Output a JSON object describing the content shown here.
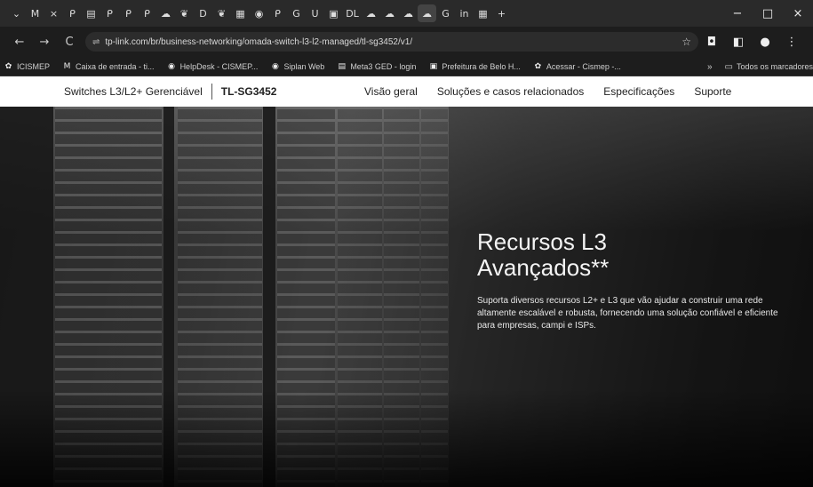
{
  "browser": {
    "tabs": [
      {
        "icon": "chevron-down-icon",
        "glyph": "⌄"
      },
      {
        "icon": "gmail-icon",
        "glyph": "M"
      },
      {
        "icon": "close-icon",
        "glyph": "×"
      },
      {
        "icon": "tplink-icon",
        "glyph": "ᑭ"
      },
      {
        "icon": "doc-icon",
        "glyph": "▤"
      },
      {
        "icon": "tplink-icon",
        "glyph": "ᑭ"
      },
      {
        "icon": "tplink-icon",
        "glyph": "ᑭ"
      },
      {
        "icon": "tplink-icon",
        "glyph": "ᑭ"
      },
      {
        "icon": "cloud-icon",
        "glyph": "☁"
      },
      {
        "icon": "leaf-icon",
        "glyph": "❦"
      },
      {
        "icon": "d-icon",
        "glyph": "D"
      },
      {
        "icon": "leaf-icon",
        "glyph": "❦"
      },
      {
        "icon": "grid-icon",
        "glyph": "▦"
      },
      {
        "icon": "globe-icon",
        "glyph": "◉"
      },
      {
        "icon": "tplink-icon",
        "glyph": "ᑭ"
      },
      {
        "icon": "google-icon",
        "glyph": "G"
      },
      {
        "icon": "u-icon",
        "glyph": "U"
      },
      {
        "icon": "image-icon",
        "glyph": "▣"
      },
      {
        "icon": "dl-icon",
        "glyph": "DL"
      },
      {
        "icon": "cloud-icon",
        "glyph": "☁"
      },
      {
        "icon": "cloud-icon",
        "glyph": "☁"
      },
      {
        "icon": "cloud-icon",
        "glyph": "☁"
      },
      {
        "icon": "cloud-icon",
        "glyph": "☁",
        "active": true
      },
      {
        "icon": "google-icon",
        "glyph": "G"
      },
      {
        "icon": "linkedin-icon",
        "glyph": "in"
      },
      {
        "icon": "grid-icon",
        "glyph": "▦"
      },
      {
        "icon": "new-tab-icon",
        "glyph": "+"
      }
    ],
    "window_controls": [
      "−",
      "□",
      "×"
    ],
    "nav": {
      "back": "←",
      "forward": "→",
      "reload": "C"
    },
    "url": "tp-link.com/br/business-networking/omada-switch-l3-l2-managed/tl-sg3452/v1/",
    "bookmarks": [
      {
        "icon": "cismep-icon",
        "glyph": "✿",
        "label": "ICISMEP"
      },
      {
        "icon": "gmail-icon",
        "glyph": "M",
        "label": "Caixa de entrada - ti..."
      },
      {
        "icon": "globe-icon",
        "glyph": "◉",
        "label": "HelpDesk - CISMEP..."
      },
      {
        "icon": "globe-icon",
        "glyph": "◉",
        "label": "Siplan Web"
      },
      {
        "icon": "doc-icon",
        "glyph": "▤",
        "label": "Meta3 GED - login"
      },
      {
        "icon": "image-icon",
        "glyph": "▣",
        "label": "Prefeitura de Belo H..."
      },
      {
        "icon": "cismep-icon",
        "glyph": "✿",
        "label": "Acessar - Cismep -..."
      }
    ],
    "bookmarks_more": "»",
    "bookmarks_folder": "Todos os marcadores"
  },
  "subnav": {
    "series": "Switches L3/L2+ Gerenciável",
    "model": "TL-SG3452",
    "links": [
      "Visão geral",
      "Soluções e casos relacionados",
      "Especificações",
      "Suporte"
    ]
  },
  "hero": {
    "title_line1": "Recursos L3",
    "title_line2": "Avançados**",
    "text": "Suporta diversos recursos L2+ e L3 que vão ajudar a construir uma rede altamente escalável e robusta, fornecendo uma solução confiável e eficiente para empresas, campi e ISPs."
  }
}
